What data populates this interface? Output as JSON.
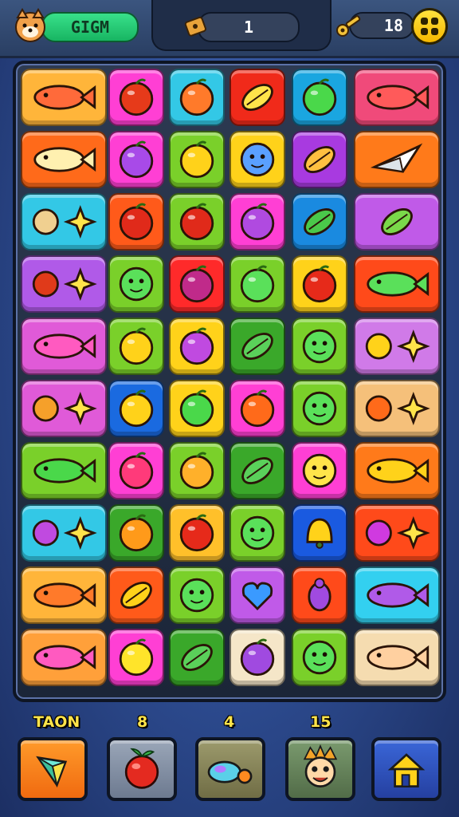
{
  "hud": {
    "left_badge_text": "GIGM",
    "center_counter": "1",
    "right_counter": "18"
  },
  "bottom_bar": {
    "labels": [
      "TAON",
      "8",
      "4",
      "15"
    ]
  },
  "board": {
    "rows": 10,
    "cols": 6,
    "tiles": [
      [
        "fish-tile",
        "fruit-tile",
        "fruit-tile",
        "leaf-tile",
        "fruit-tile",
        "fish-tile"
      ],
      [
        "fish-tile",
        "fruit-tile",
        "fruit-tile",
        "smiley-tile",
        "leaf-tile",
        "origami-tile"
      ],
      [
        "box-star-tile",
        "fruit-tile",
        "fruit-tile",
        "fruit-tile",
        "leaf-tile",
        "leaf-tile"
      ],
      [
        "rocket-tile",
        "smiley-tile",
        "fruit-tile",
        "fruit-tile",
        "fruit-tile",
        "fish-tile"
      ],
      [
        "fish-tile",
        "fruit-tile",
        "fruit-tile",
        "leaf-tile",
        "smiley-tile",
        "star-pencil-tile"
      ],
      [
        "pencil-tile",
        "fruit-tile",
        "fruit-tile",
        "fruit-tile",
        "smiley-tile",
        "sun-house-tile"
      ],
      [
        "fish-tile",
        "fruit-tile",
        "fruit-tile",
        "leaf-tile",
        "smiley-tile",
        "fish-tile"
      ],
      [
        "gear-star-tile",
        "fruit-tile",
        "fruit-tile",
        "smiley-tile",
        "bell-tile",
        "gear-star-tile"
      ],
      [
        "fish-tile",
        "leaf-tile",
        "smiley-tile",
        "heart-tile",
        "bug-tile",
        "fish-tile"
      ],
      [
        "fish-tile",
        "fruit-tile",
        "leaf-tile",
        "fruit-tile",
        "smiley-tile",
        "fish-tile"
      ]
    ]
  },
  "colors": {
    "hud_green": "#22c46e",
    "accent_yellow": "#ffd21a",
    "board_frame": "#1b2538"
  }
}
